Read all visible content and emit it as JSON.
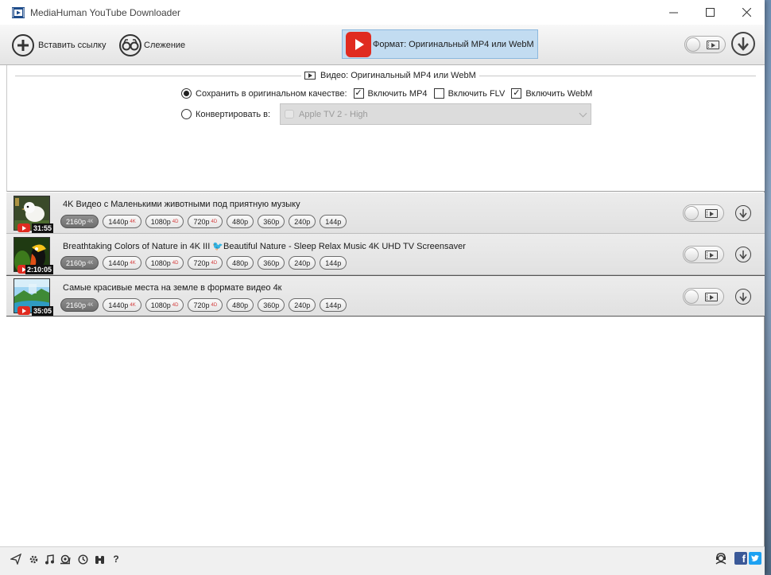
{
  "window": {
    "title": "MediaHuman YouTube Downloader"
  },
  "toolbar": {
    "paste_label": "Вставить ссылку",
    "tracking_label": "Слежение",
    "format_label": "Формат: Оригинальный MP4 или WebM"
  },
  "settings": {
    "section_title": "Видео: Оригинальный MP4 или WebM",
    "keep_original_label": "Сохранить в оригинальном качестве:",
    "include_mp4_label": "Включить MP4",
    "include_flv_label": "Включить FLV",
    "include_webm_label": "Включить WebM",
    "include_mp4": true,
    "include_flv": false,
    "include_webm": true,
    "convert_label": "Конвертировать в:",
    "convert_value": "Apple TV 2 - High",
    "selected_mode": "keep_original"
  },
  "videos": [
    {
      "title": "4K Видео с Маленькими животными под приятную музыку",
      "duration": "31:55",
      "qualities": [
        {
          "label": "2160р",
          "badge": "4K",
          "active": true
        },
        {
          "label": "1440р",
          "badge": "4K",
          "active": false
        },
        {
          "label": "1080р",
          "badge": "4D",
          "active": false
        },
        {
          "label": "720р",
          "badge": "4D",
          "active": false
        },
        {
          "label": "480р",
          "badge": "",
          "active": false
        },
        {
          "label": "360р",
          "badge": "",
          "active": false
        },
        {
          "label": "240р",
          "badge": "",
          "active": false
        },
        {
          "label": "144р",
          "badge": "",
          "active": false
        }
      ]
    },
    {
      "title": "Breathtaking Colors of Nature in 4K III 🐦Beautiful Nature - Sleep Relax Music 4K UHD TV Screensaver",
      "duration": "2:10:05",
      "qualities": [
        {
          "label": "2160р",
          "badge": "4K",
          "active": true
        },
        {
          "label": "1440р",
          "badge": "4K",
          "active": false
        },
        {
          "label": "1080р",
          "badge": "4D",
          "active": false
        },
        {
          "label": "720р",
          "badge": "4D",
          "active": false
        },
        {
          "label": "480р",
          "badge": "",
          "active": false
        },
        {
          "label": "360р",
          "badge": "",
          "active": false
        },
        {
          "label": "240р",
          "badge": "",
          "active": false
        },
        {
          "label": "144р",
          "badge": "",
          "active": false
        }
      ]
    },
    {
      "title": "Самые красивые места на земле в формате видео 4к",
      "duration": "35:05",
      "qualities": [
        {
          "label": "2160р",
          "badge": "4K",
          "active": true
        },
        {
          "label": "1440р",
          "badge": "4K",
          "active": false
        },
        {
          "label": "1080р",
          "badge": "4D",
          "active": false
        },
        {
          "label": "720р",
          "badge": "4D",
          "active": false
        },
        {
          "label": "480р",
          "badge": "",
          "active": false
        },
        {
          "label": "360р",
          "badge": "",
          "active": false
        },
        {
          "label": "240р",
          "badge": "",
          "active": false
        },
        {
          "label": "144р",
          "badge": "",
          "active": false
        }
      ]
    }
  ],
  "bottombar": {
    "help_label": "?",
    "facebook_label": "f"
  },
  "colors": {
    "accent": "#c2dcf1",
    "youtube": "#e02b20",
    "facebook": "#3b5998",
    "twitter": "#1da1f2"
  }
}
